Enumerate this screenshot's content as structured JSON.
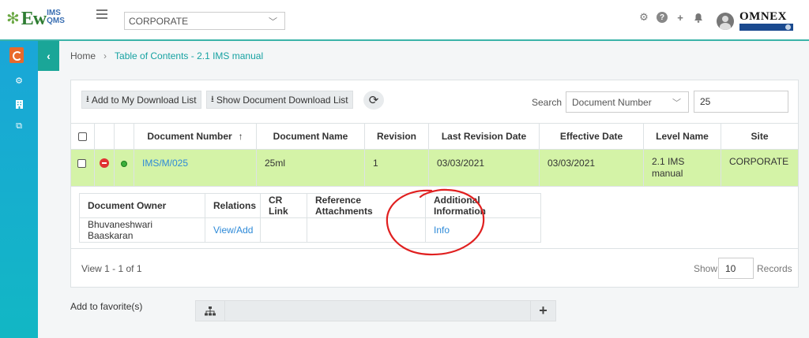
{
  "header": {
    "logo_main": "Ew",
    "logo_sup": "IMS",
    "logo_sub": "QMS",
    "org_select": "CORPORATE",
    "brand": "OMNEX",
    "icons": [
      "gear-icon",
      "help-icon",
      "plus-icon",
      "bell-icon",
      "user-avatar"
    ]
  },
  "rail": {
    "icons": [
      "document-icon",
      "gears-icon",
      "building-icon",
      "copy-icon"
    ]
  },
  "breadcrumb": {
    "home": "Home",
    "current": "Table of Contents - 2.1 IMS manual"
  },
  "toolbar": {
    "add_download": "Add to My Download List",
    "show_download": "Show Document Download List",
    "search_label": "Search",
    "search_field": "Document Number",
    "search_value": "25"
  },
  "table": {
    "columns": [
      "Document Number",
      "Document Name",
      "Revision",
      "Last Revision Date",
      "Effective Date",
      "Level Name",
      "Site"
    ],
    "sort_indicator": "↑",
    "rows": [
      {
        "document_number": "IMS/M/025",
        "document_name": "25ml",
        "revision": "1",
        "last_revision_date": "03/03/2021",
        "effective_date": "03/03/2021",
        "level_name": "2.1 IMS manual",
        "site": "CORPORATE"
      }
    ]
  },
  "details": {
    "columns": [
      "Document Owner",
      "Relations",
      "CR Link",
      "Reference Attachments",
      "Additional Information"
    ],
    "owner": "Bhuvaneshwari Baaskaran",
    "relations": "View/Add",
    "cr_link": "",
    "reference_attachments": "",
    "additional_info": "Info"
  },
  "pager": {
    "view_text": "View 1 - 1 of 1",
    "show_label": "Show",
    "page_size": "10",
    "records_label": "Records"
  },
  "favorites": {
    "label": "Add to favorite(s)",
    "value": ""
  },
  "colors": {
    "accent": "#1aa698",
    "row_highlight": "#d4f3a7",
    "link": "#2e8ad8",
    "annotation": "#e02020"
  }
}
